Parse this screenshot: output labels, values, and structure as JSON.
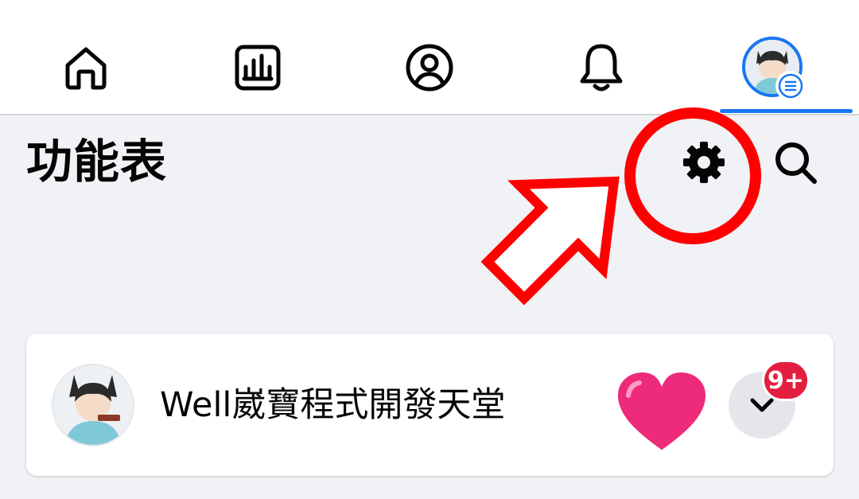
{
  "nav": {
    "tabs": [
      {
        "id": "home",
        "icon": "home-icon"
      },
      {
        "id": "dashboard",
        "icon": "bar-chart-icon"
      },
      {
        "id": "profile",
        "icon": "user-circle-icon"
      },
      {
        "id": "notifications",
        "icon": "bell-icon"
      },
      {
        "id": "menu",
        "icon": "profile-avatar",
        "active": true
      }
    ],
    "active_color": "#1877f2"
  },
  "header": {
    "title": "功能表",
    "settings_icon": "gear-icon",
    "search_icon": "search-icon"
  },
  "profile_card": {
    "name": "Well崴寶程式開發天堂",
    "reaction_icon": "heart-icon",
    "expand_icon": "chevron-down-icon",
    "badge": "9+",
    "badge_color": "#e41e3f"
  },
  "annotation": {
    "color": "#ff0000",
    "shapes": [
      "circle",
      "arrow"
    ]
  }
}
